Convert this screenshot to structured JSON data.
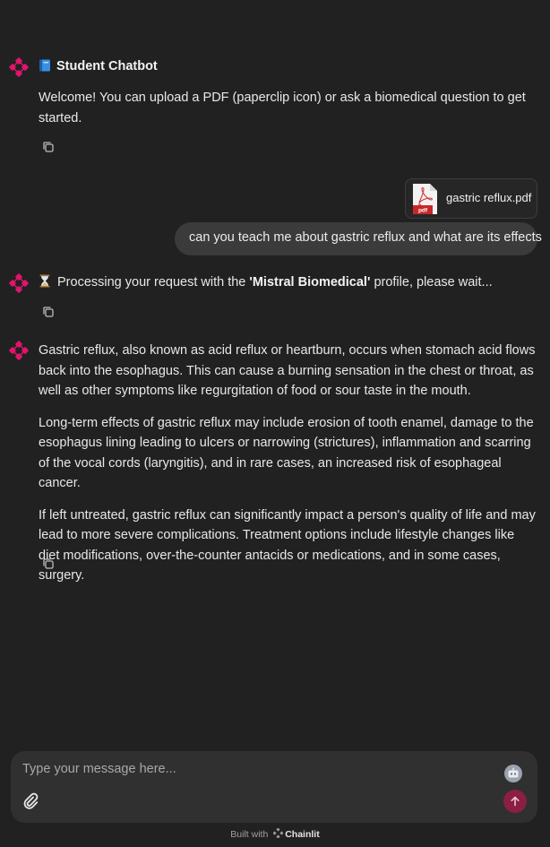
{
  "app": {
    "accent": "#e0146e",
    "background": "#212121"
  },
  "messages": {
    "welcome": {
      "title": "Student Chatbot",
      "title_icon": "book-icon",
      "text": "Welcome! You can upload a PDF (paperclip icon) or ask a biomedical question to get started."
    },
    "attachment": {
      "file_name": "gastric reflux.pdf",
      "file_type_label": "pdf",
      "icon": "pdf-file-icon"
    },
    "user": {
      "text": "can you teach me about gastric reflux and what are its effects"
    },
    "processing": {
      "icon": "hourglass-icon",
      "prefix": "Processing your request with the ",
      "profile": "'Mistral Biomedical'",
      "suffix": " profile, please wait..."
    },
    "answer": {
      "paragraphs": [
        "Gastric reflux, also known as acid reflux or heartburn, occurs when stomach acid flows back into the esophagus. This can cause a burning sensation in the chest or throat, as well as other symptoms like regurgitation of food or sour taste in the mouth.",
        "Long-term effects of gastric reflux may include erosion of tooth enamel, damage to the esophagus lining leading to ulcers or narrowing (strictures), inflammation and scarring of the vocal cords (laryngitis), and in rare cases, an increased risk of esophageal cancer.",
        "If left untreated, gastric reflux can significantly impact a person's quality of life and may lead to more severe complications. Treatment options include lifestyle changes like diet modifications, over-the-counter antacids or medications, and in some cases, surgery."
      ]
    }
  },
  "composer": {
    "placeholder": "Type your message here...",
    "value": ""
  },
  "footer": {
    "prefix": "Built with",
    "brand": "Chainlit"
  }
}
